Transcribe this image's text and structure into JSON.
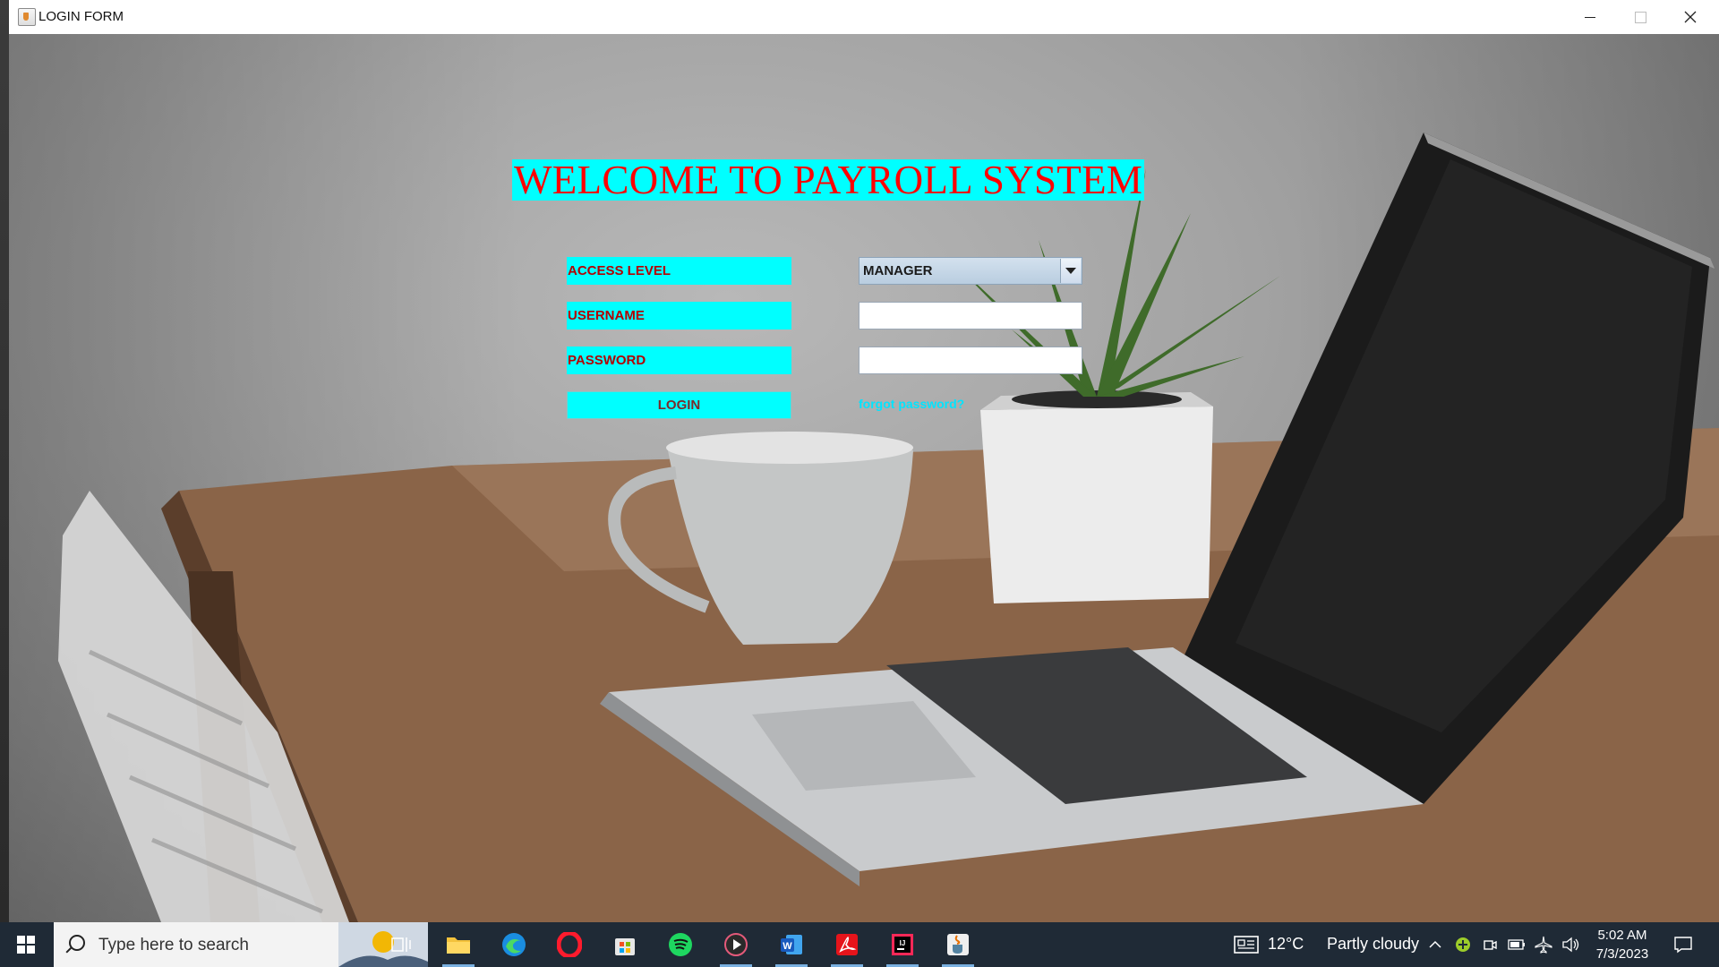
{
  "window": {
    "title": "LOGIN FORM"
  },
  "form": {
    "heading": "WELCOME TO PAYROLL SYSTEM",
    "access_level_label": "ACCESS LEVEL",
    "username_label": "USERNAME",
    "password_label": "PASSWORD",
    "access_level_value": "MANAGER",
    "username_value": "",
    "password_value": "",
    "login_label": "LOGIN",
    "forgot_label": "forgot password?"
  },
  "taskbar": {
    "search_placeholder": "Type here to search",
    "apps": [
      "task-view",
      "file-explorer",
      "edge",
      "opera",
      "microsoft-store",
      "spotify",
      "media-player",
      "word",
      "acrobat",
      "intellij",
      "java"
    ],
    "weather_temp": "12°C",
    "weather_desc": "Partly cloudy",
    "time": "5:02 AM",
    "date": "7/3/2023"
  },
  "colors": {
    "label_bg": "#00ffff",
    "heading_text": "#ff0000",
    "label_text": "#b30000",
    "link": "#00e5ff"
  }
}
